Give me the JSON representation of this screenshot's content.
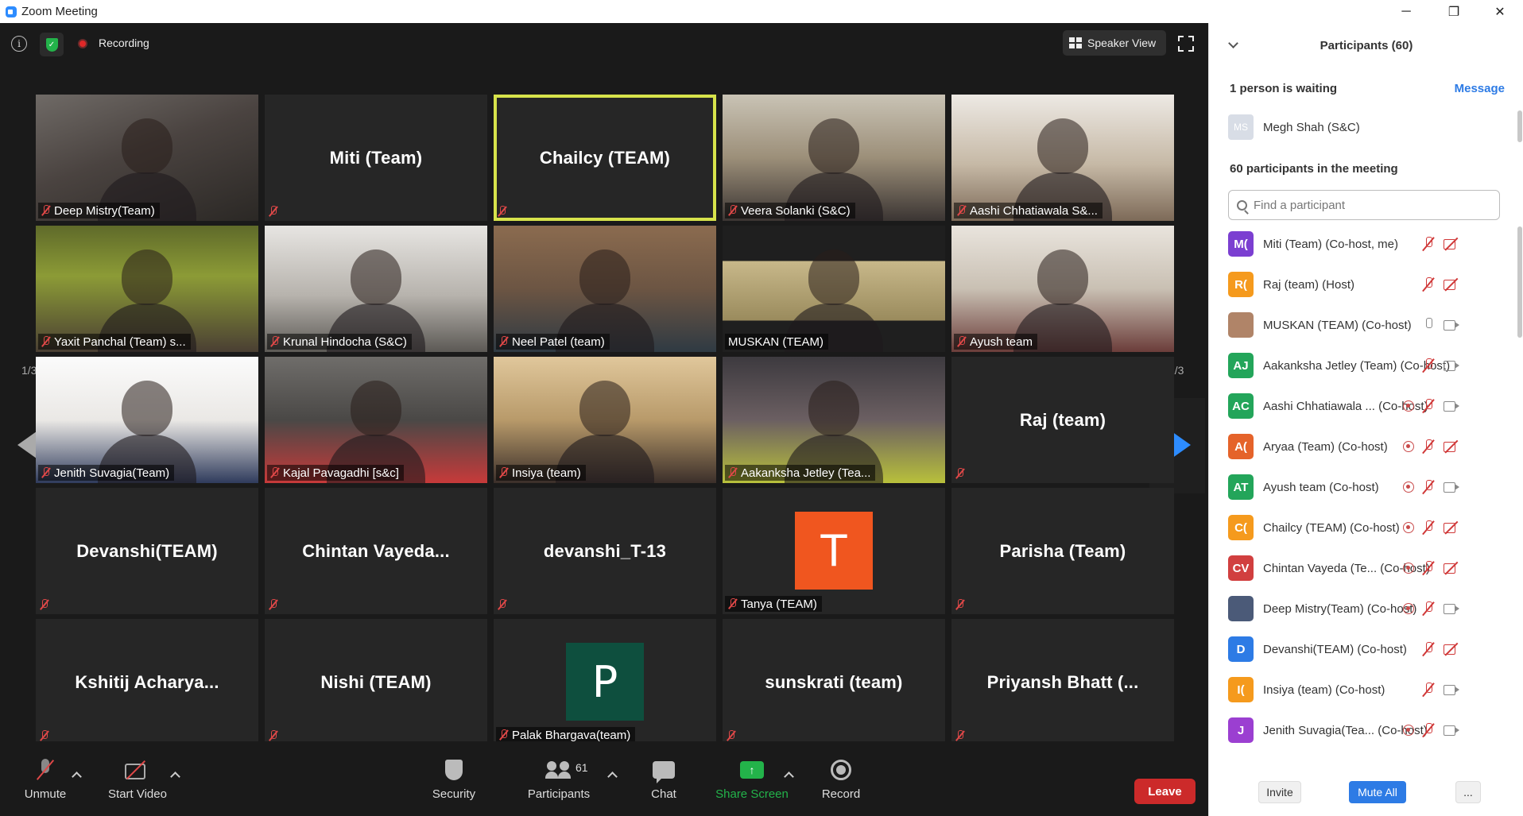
{
  "window": {
    "title": "Zoom Meeting",
    "minimize": "─",
    "maximize": "❐",
    "close": "✕"
  },
  "topbar": {
    "info_glyph": "i",
    "shield_glyph": "✓",
    "recording_label": "Recording",
    "view_label": "Speaker View"
  },
  "gallery": {
    "page_left": "1/3",
    "page_right": "1/3",
    "tiles": [
      {
        "name": "Deep Mistry(Team)",
        "video": true
      },
      {
        "name": "Miti (Team)",
        "display": "Miti (Team)",
        "video": false
      },
      {
        "name": "Chailcy (TEAM)",
        "display": "Chailcy (TEAM)",
        "video": false,
        "active": true
      },
      {
        "name": "Veera Solanki (S&C)",
        "video": true
      },
      {
        "name": "Aashi Chhatiawala S&...",
        "video": true
      },
      {
        "name": "Yaxit Panchal (Team) s...",
        "video": true
      },
      {
        "name": "Krunal Hindocha (S&C)",
        "video": true
      },
      {
        "name": "Neel Patel (team)",
        "video": true
      },
      {
        "name": "MUSKAN (TEAM)",
        "video": true
      },
      {
        "name": "Ayush team",
        "video": true
      },
      {
        "name": "Jenith Suvagia(Team)",
        "video": true
      },
      {
        "name": "Kajal Pavagadhi [s&c]",
        "video": true
      },
      {
        "name": "Insiya (team)",
        "video": true
      },
      {
        "name": "Aakanksha Jetley (Tea...",
        "video": true
      },
      {
        "name": "Raj (team)",
        "display": "Raj (team)",
        "video": false
      },
      {
        "name": "Devanshi(TEAM)",
        "display": "Devanshi(TEAM)",
        "video": false
      },
      {
        "name": "Chintan Vayeda...",
        "display": "Chintan  Vayeda...",
        "video": false
      },
      {
        "name": "devanshi_T-13",
        "display": "devanshi_T-13",
        "video": false
      },
      {
        "name": "Tanya (TEAM)",
        "avatar_letter": "T",
        "avatar_color": "#f0561f",
        "video": false
      },
      {
        "name": "Parisha (Team)",
        "display": "Parisha (Team)",
        "video": false
      },
      {
        "name": "Kshitij Acharya...",
        "display": "Kshitij  Acharya...",
        "video": false
      },
      {
        "name": "Nishi (TEAM)",
        "display": "Nishi (TEAM)",
        "video": false
      },
      {
        "name": "Palak Bhargava(team)",
        "avatar_letter": "P",
        "avatar_color": "#0e4f3e",
        "video": false
      },
      {
        "name": "sunskrati (team)",
        "display": "sunskrati (team)",
        "video": false
      },
      {
        "name": "Priyansh Bhatt (...",
        "display": "Priyansh  Bhatt (...",
        "video": false
      }
    ]
  },
  "toolbar": {
    "unmute": "Unmute",
    "start_video": "Start Video",
    "security": "Security",
    "participants": "Participants",
    "participants_count": "61",
    "chat": "Chat",
    "share_screen": "Share Screen",
    "share_glyph": "↑",
    "record": "Record",
    "leave": "Leave"
  },
  "panel": {
    "title": "Participants (60)",
    "waiting_text": "1 person is waiting",
    "message_link": "Message",
    "waiting_person": {
      "initials": "MS",
      "name": "Megh Shah (S&C)"
    },
    "in_meeting_text": "60 participants in the meeting",
    "search_placeholder": "Find a participant",
    "participants": [
      {
        "initials": "M(",
        "color": "#7b3fd1",
        "name": "Miti (Team) (Co-host, me)",
        "rec": false,
        "mic": "off",
        "cam": "off"
      },
      {
        "initials": "R(",
        "color": "#f59a1d",
        "name": "Raj (team) (Host)",
        "rec": false,
        "mic": "off",
        "cam": "off"
      },
      {
        "initials": "",
        "color": "#b08468",
        "name": "MUSKAN (TEAM) (Co-host)",
        "rec": false,
        "mic": "on",
        "cam": "on"
      },
      {
        "initials": "AJ",
        "color": "#23a55a",
        "name": "Aakanksha Jetley (Team) (Co-host)",
        "rec": false,
        "mic": "off",
        "cam": "on"
      },
      {
        "initials": "AC",
        "color": "#23a55a",
        "name": "Aashi Chhatiawala ...  (Co-host)",
        "rec": true,
        "mic": "off",
        "cam": "on"
      },
      {
        "initials": "A(",
        "color": "#e5632a",
        "name": "Aryaa (Team) (Co-host)",
        "rec": true,
        "mic": "off",
        "cam": "off"
      },
      {
        "initials": "AT",
        "color": "#23a55a",
        "name": "Ayush team (Co-host)",
        "rec": true,
        "mic": "off",
        "cam": "on"
      },
      {
        "initials": "C(",
        "color": "#f59a1d",
        "name": "Chailcy (TEAM) (Co-host)",
        "rec": true,
        "mic": "off",
        "cam": "off"
      },
      {
        "initials": "CV",
        "color": "#d13f3f",
        "name": "Chintan Vayeda (Te...  (Co-host)",
        "rec": true,
        "mic": "off",
        "cam": "off"
      },
      {
        "initials": "",
        "color": "#4b5a78",
        "name": "Deep Mistry(Team) (Co-host)",
        "rec": true,
        "mic": "off",
        "cam": "on"
      },
      {
        "initials": "D",
        "color": "#2d7be5",
        "name": "Devanshi(TEAM) (Co-host)",
        "rec": false,
        "mic": "off",
        "cam": "off"
      },
      {
        "initials": "I(",
        "color": "#f59a1d",
        "name": "Insiya (team) (Co-host)",
        "rec": false,
        "mic": "off",
        "cam": "on"
      },
      {
        "initials": "J",
        "color": "#9b3fd1",
        "name": "Jenith Suvagia(Tea...  (Co-host)",
        "rec": true,
        "mic": "off",
        "cam": "on"
      }
    ],
    "invite": "Invite",
    "mute_all": "Mute All",
    "more": "..."
  }
}
